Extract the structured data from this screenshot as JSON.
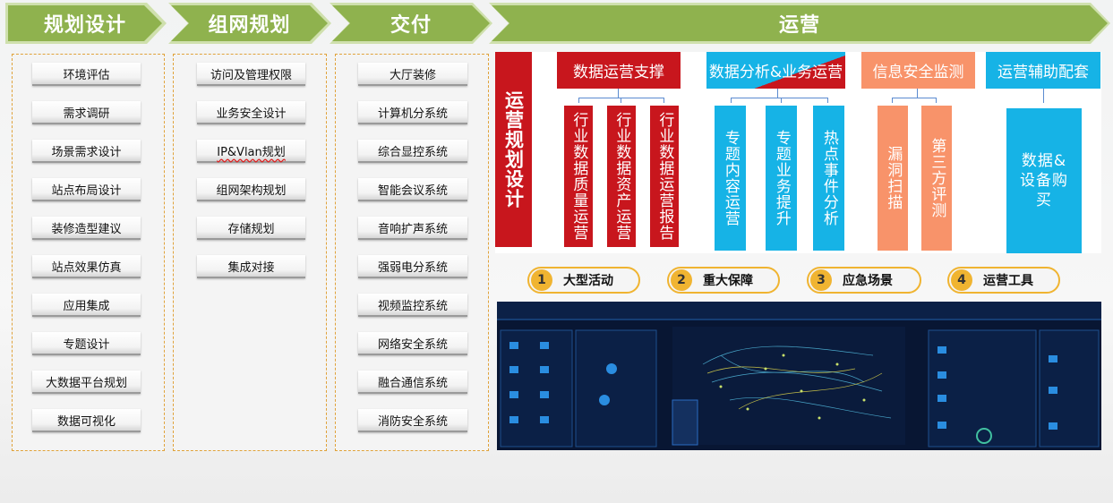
{
  "phases": [
    "规划设计",
    "组网规划",
    "交付",
    "运营"
  ],
  "planning_items": [
    "环境评估",
    "需求调研",
    "场景需求设计",
    "站点布局设计",
    "装修造型建议",
    "站点效果仿真",
    "应用集成",
    "专题设计",
    "大数据平台规划",
    "数据可视化"
  ],
  "network_items": [
    "访问及管理权限",
    "业务安全设计",
    "IP&Vlan规划",
    "组网架构规划",
    "存储规划",
    "集成对接"
  ],
  "delivery_items": [
    "大厅装修",
    "计算机分系统",
    "综合显控系统",
    "智能会议系统",
    "音响扩声系统",
    "强弱电分系统",
    "视频监控系统",
    "网络安全系统",
    "融合通信系统",
    "消防安全系统"
  ],
  "operations": {
    "left_label": "运营规划设计",
    "groups": [
      {
        "title": "数据运营支撑",
        "items": [
          "行业数据质量运营",
          "行业数据资产运营",
          "行业数据运营报告"
        ]
      },
      {
        "title": "数据分析&业务运营",
        "items": [
          "专题内容运营",
          "专题业务提升",
          "热点事件分析"
        ]
      },
      {
        "title": "信息安全监测",
        "items": [
          "漏洞扫描",
          "第三方评测"
        ]
      },
      {
        "title": "运营辅助配套",
        "items": [
          "数据&设备购买"
        ]
      }
    ]
  },
  "scenarios": [
    {
      "num": "1",
      "label": "大型活动"
    },
    {
      "num": "2",
      "label": "重大保障"
    },
    {
      "num": "3",
      "label": "应急场景"
    },
    {
      "num": "4",
      "label": "运营工具"
    }
  ],
  "colors": {
    "phase_green": "#8fb24e",
    "ops_red": "#c8161d",
    "ops_cyan": "#16b3e6",
    "ops_orange": "#f8936a",
    "pill_gold": "#f0b431"
  }
}
